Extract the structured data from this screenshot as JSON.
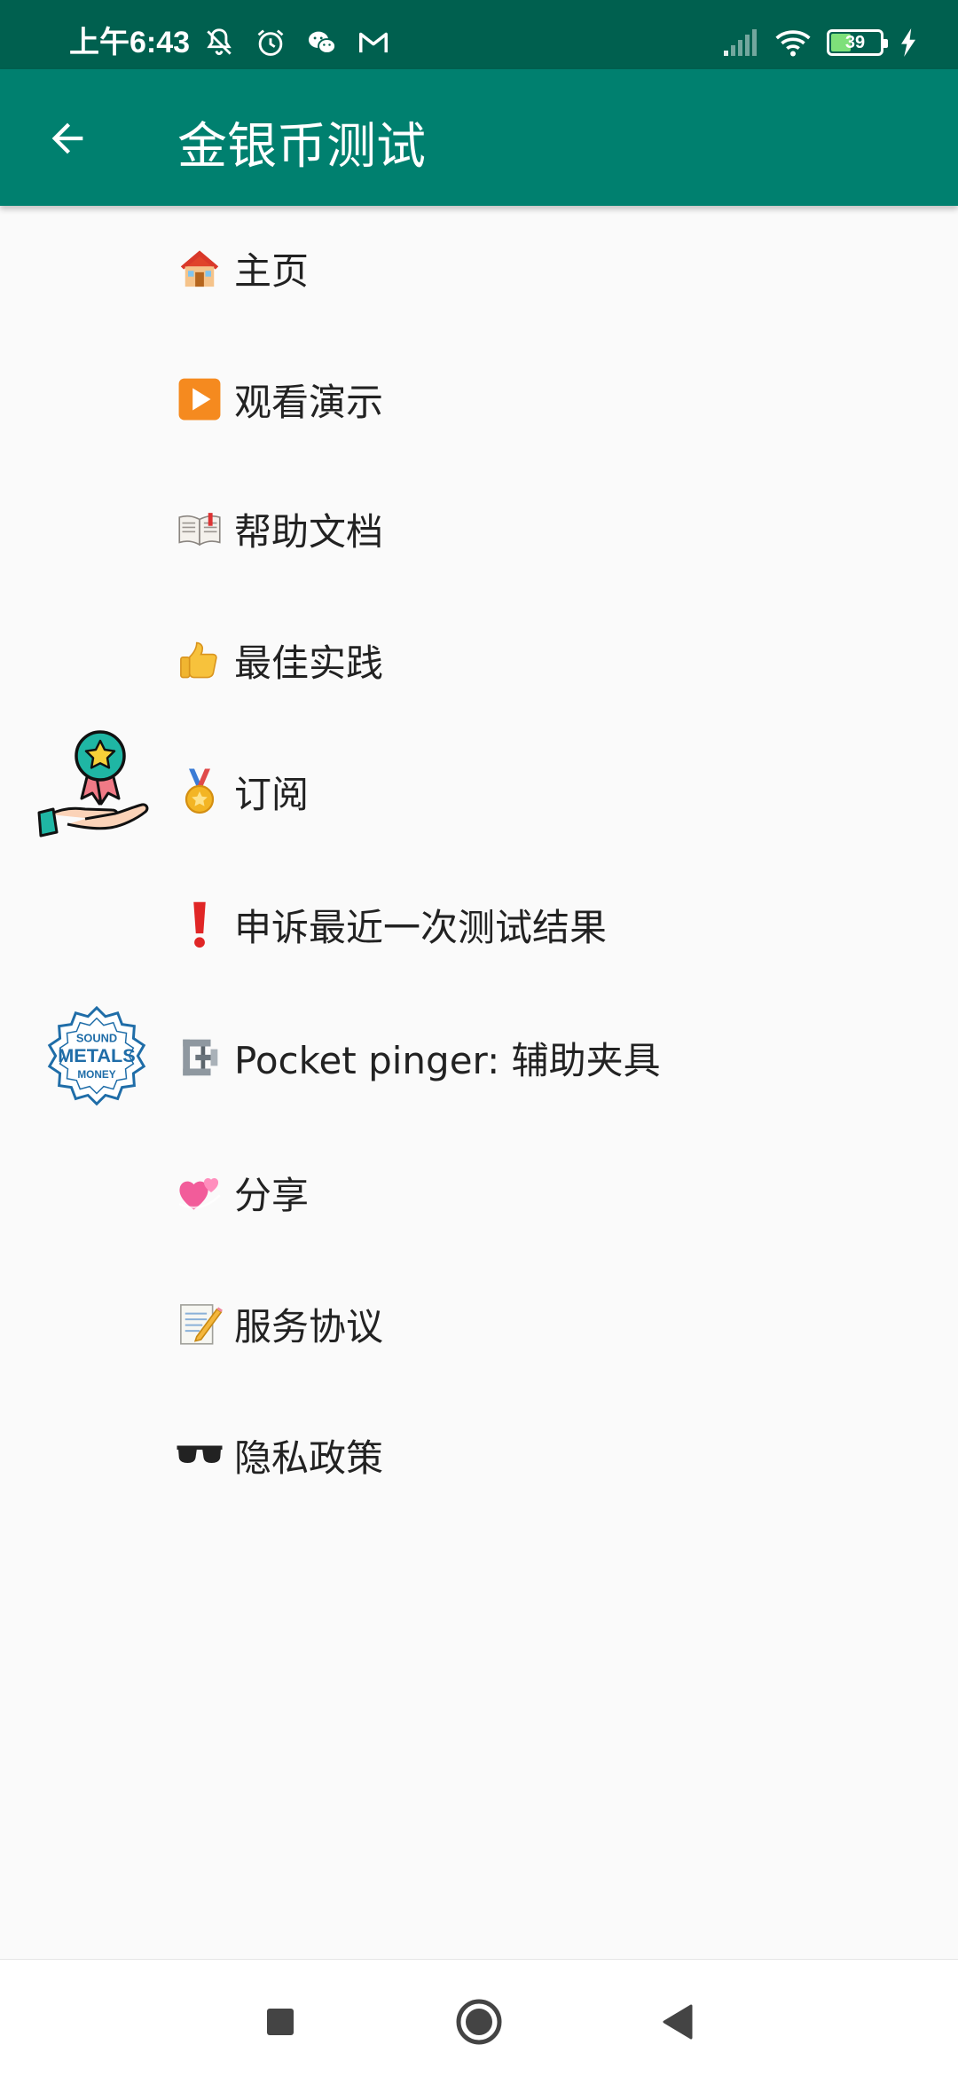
{
  "status_bar": {
    "time": "上午6:43",
    "battery_level": "39",
    "icons_left": [
      "mute-icon",
      "alarm-icon",
      "wechat-icon",
      "gmail-icon"
    ],
    "icons_right": [
      "signal-icon",
      "wifi-icon",
      "battery-icon",
      "charging-icon"
    ]
  },
  "app_bar": {
    "title": "金银币测试",
    "back_icon": "arrow-back-icon",
    "color": "#00806f"
  },
  "menu": {
    "items": [
      {
        "icon": "house-icon",
        "label": "主页"
      },
      {
        "icon": "play-button-icon",
        "label": "观看演示"
      },
      {
        "icon": "open-book-icon",
        "label": "帮助文档"
      },
      {
        "icon": "thumbs-up-icon",
        "label": "最佳实践"
      },
      {
        "icon": "medal-icon",
        "label": "订阅"
      },
      {
        "icon": "exclamation-icon",
        "label": "申诉最近一次测试结果"
      },
      {
        "icon": "clamp-icon",
        "label": "Pocket pinger: 辅助夹具"
      },
      {
        "icon": "hearts-icon",
        "label": "分享"
      },
      {
        "icon": "memo-icon",
        "label": "服务协议"
      },
      {
        "icon": "sunglasses-icon",
        "label": "隐私政策"
      }
    ],
    "badges": {
      "metals_badge": {
        "top": "SOUND",
        "middle": "METALS",
        "bottom": "MONEY"
      }
    }
  },
  "nav_bar": {
    "icons": [
      "recents-square-icon",
      "home-circle-icon",
      "back-triangle-icon"
    ]
  }
}
